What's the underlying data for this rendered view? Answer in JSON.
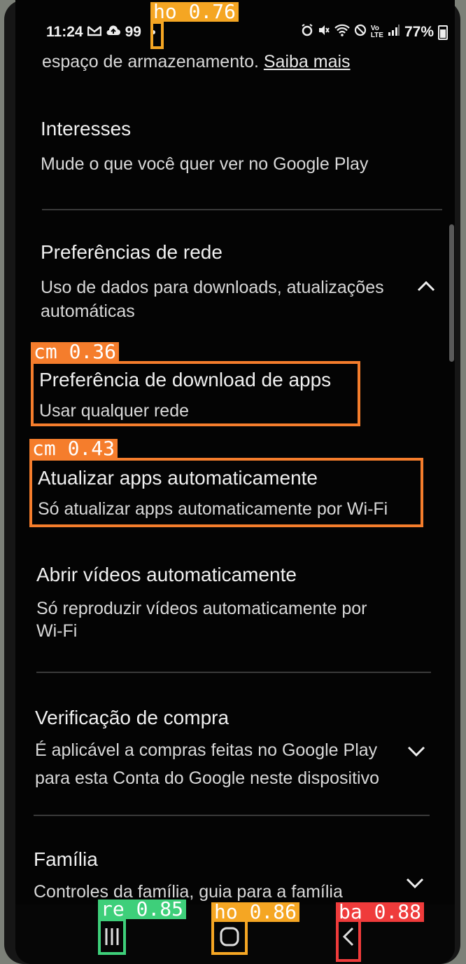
{
  "status_bar": {
    "time": "11:24",
    "left_extra": "99",
    "battery": "77%",
    "left_icons": [
      "gmail-icon",
      "cloud-upload-icon"
    ],
    "right_icons": [
      "alarm-icon",
      "mute-icon",
      "wifi-icon",
      "dnd-icon",
      "volte-icon",
      "signal-icon",
      "battery-icon"
    ]
  },
  "content": {
    "top_text": "espaço de armazenamento.",
    "top_link": "Saiba mais",
    "sections": [
      {
        "title": "Interesses",
        "subtitle": "Mude o que você quer ver no Google Play"
      },
      {
        "title": "Preferências de rede",
        "subtitle_line1": "Uso de dados para downloads, atualizações",
        "subtitle_line2": "automáticas",
        "expanded": true
      },
      {
        "title": "Preferência de download de apps",
        "subtitle": "Usar qualquer rede"
      },
      {
        "title": "Atualizar apps automaticamente",
        "subtitle": "Só atualizar apps automaticamente por Wi-Fi"
      },
      {
        "title": "Abrir vídeos automaticamente",
        "subtitle_line1": "Só reproduzir vídeos automaticamente por",
        "subtitle_line2": "Wi-Fi"
      },
      {
        "title": "Verificação de compra",
        "subtitle_line1": "É aplicável a compras feitas no Google Play",
        "subtitle_line2": "para esta Conta do Google neste dispositivo",
        "expanded": false
      },
      {
        "title": "Família",
        "subtitle": "Controles da família, guia para a família",
        "expanded": false
      }
    ]
  },
  "annotations": [
    {
      "label": "ho 0.76",
      "color": "#f5a623"
    },
    {
      "label": "cm 0.36",
      "color": "#f57d2c"
    },
    {
      "label": "cm 0.43",
      "color": "#f57d2c"
    },
    {
      "label": "re 0.85",
      "color": "#3ecf7a"
    },
    {
      "label": "ho 0.86",
      "color": "#f5a623"
    },
    {
      "label": "ba 0.88",
      "color": "#ef3b3b"
    }
  ],
  "nav_bar": {
    "icons": [
      "recents-icon",
      "home-icon",
      "back-icon"
    ]
  }
}
